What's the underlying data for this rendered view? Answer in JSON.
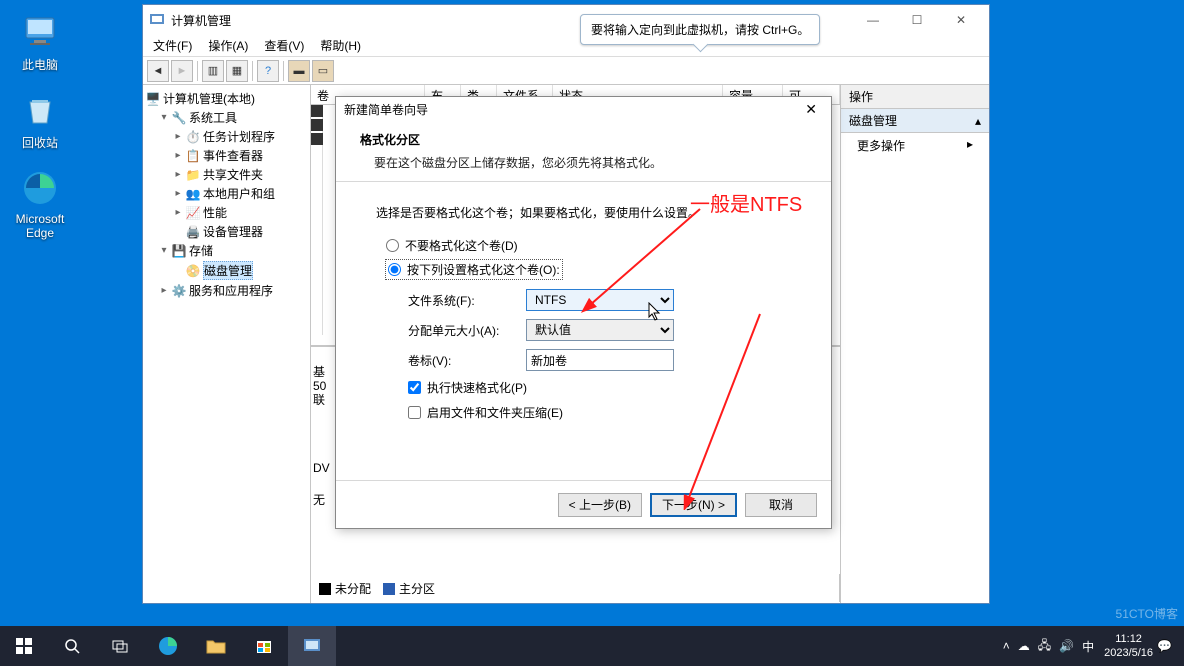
{
  "desktop": {
    "this_pc": "此电脑",
    "recycle": "回收站",
    "edge": "Microsoft\nEdge"
  },
  "tooltip": "要将输入定向到此虚拟机，请按 Ctrl+G。",
  "annotation": "一般是NTFS",
  "cm": {
    "title": "计算机管理",
    "menu": {
      "file": "文件(F)",
      "action": "操作(A)",
      "view": "查看(V)",
      "help": "帮助(H)"
    },
    "tree": {
      "root": "计算机管理(本地)",
      "sys_tools": "系统工具",
      "task_sched": "任务计划程序",
      "event_viewer": "事件查看器",
      "shared": "共享文件夹",
      "users": "本地用户和组",
      "perf": "性能",
      "devmgr": "设备管理器",
      "storage": "存储",
      "diskmgmt": "磁盘管理",
      "services": "服务和应用程序"
    },
    "cols": {
      "vol": "卷",
      "layout": "布局",
      "type": "类型",
      "fs": "文件系统",
      "status": "状态",
      "cap": "容量",
      "free": "可"
    },
    "side_left": {
      "basic": "基",
      "g50": "50",
      "online": "联",
      "dv": "DV",
      "none": "无"
    },
    "actions": {
      "header": "操作",
      "group": "磁盘管理",
      "more": "更多操作"
    },
    "legend": {
      "unalloc": "未分配",
      "primary": "主分区"
    }
  },
  "wizard": {
    "title": "新建简单卷向导",
    "h": "格式化分区",
    "sub": "要在这个磁盘分区上储存数据，您必须先将其格式化。",
    "prompt": "选择是否要格式化这个卷；如果要格式化，要使用什么设置。",
    "radio_no": "不要格式化这个卷(D)",
    "radio_yes": "按下列设置格式化这个卷(O):",
    "fs_label": "文件系统(F):",
    "fs_value": "NTFS",
    "alloc_label": "分配单元大小(A):",
    "alloc_value": "默认值",
    "vol_label": "卷标(V):",
    "vol_value": "新加卷",
    "quick": "执行快速格式化(P)",
    "compress": "启用文件和文件夹压缩(E)",
    "back": "< 上一步(B)",
    "next": "下一步(N) >",
    "cancel": "取消"
  },
  "taskbar": {
    "ime": "中",
    "time": "11:12",
    "date": "2023/5/16"
  },
  "watermark": "51CTO博客"
}
